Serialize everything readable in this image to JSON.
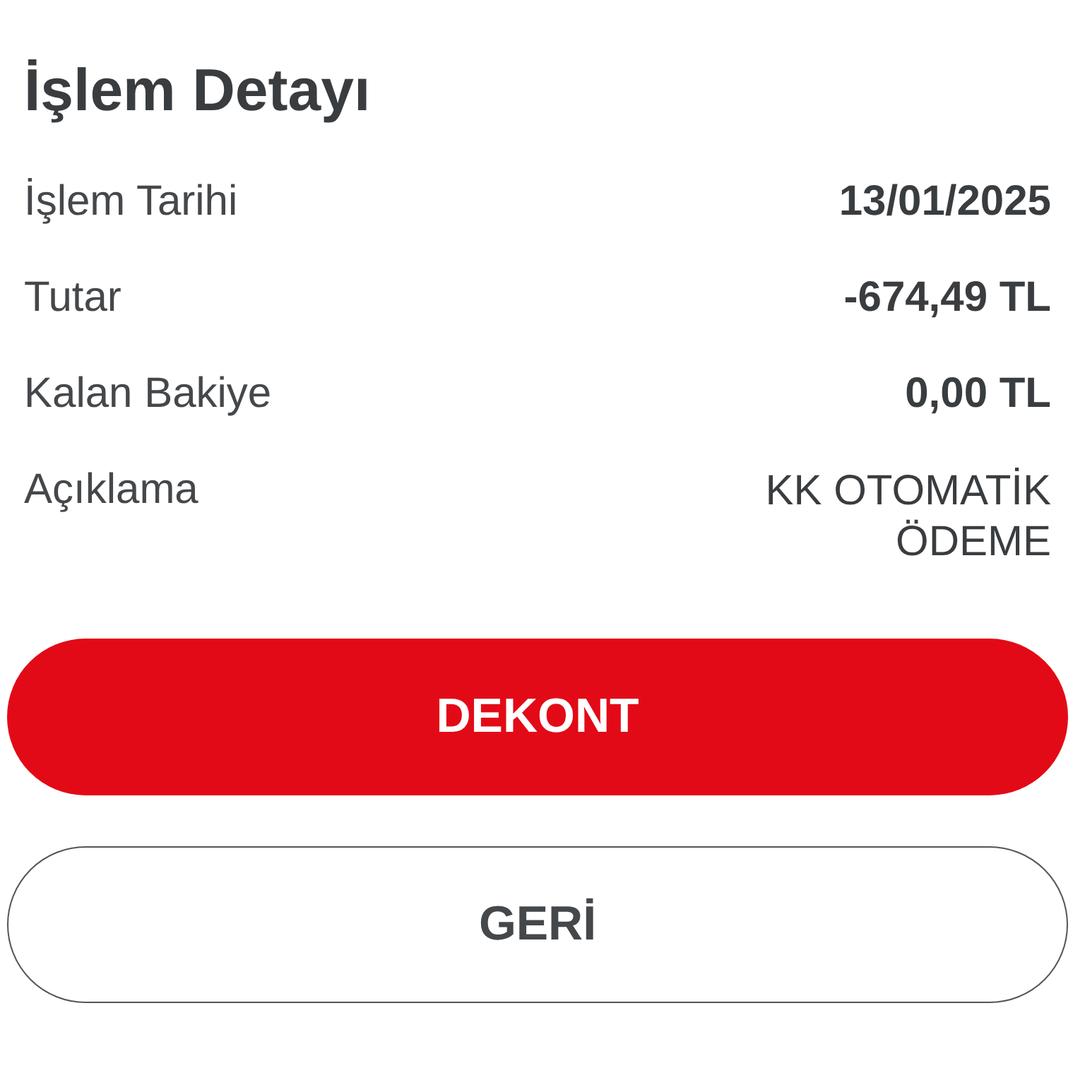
{
  "title": "İşlem Detayı",
  "details": [
    {
      "label": "İşlem Tarihi",
      "value": "13/01/2025"
    },
    {
      "label": "Tutar",
      "value": "-674,49 TL"
    },
    {
      "label": "Kalan Bakiye",
      "value": "0,00 TL"
    },
    {
      "label": "Açıklama",
      "value": "KK OTOMATİK ÖDEME",
      "kind": "plain"
    }
  ],
  "buttons": [
    {
      "label": "DEKONT",
      "kind": "primary"
    },
    {
      "label": "GERİ",
      "kind": "secondary"
    }
  ]
}
